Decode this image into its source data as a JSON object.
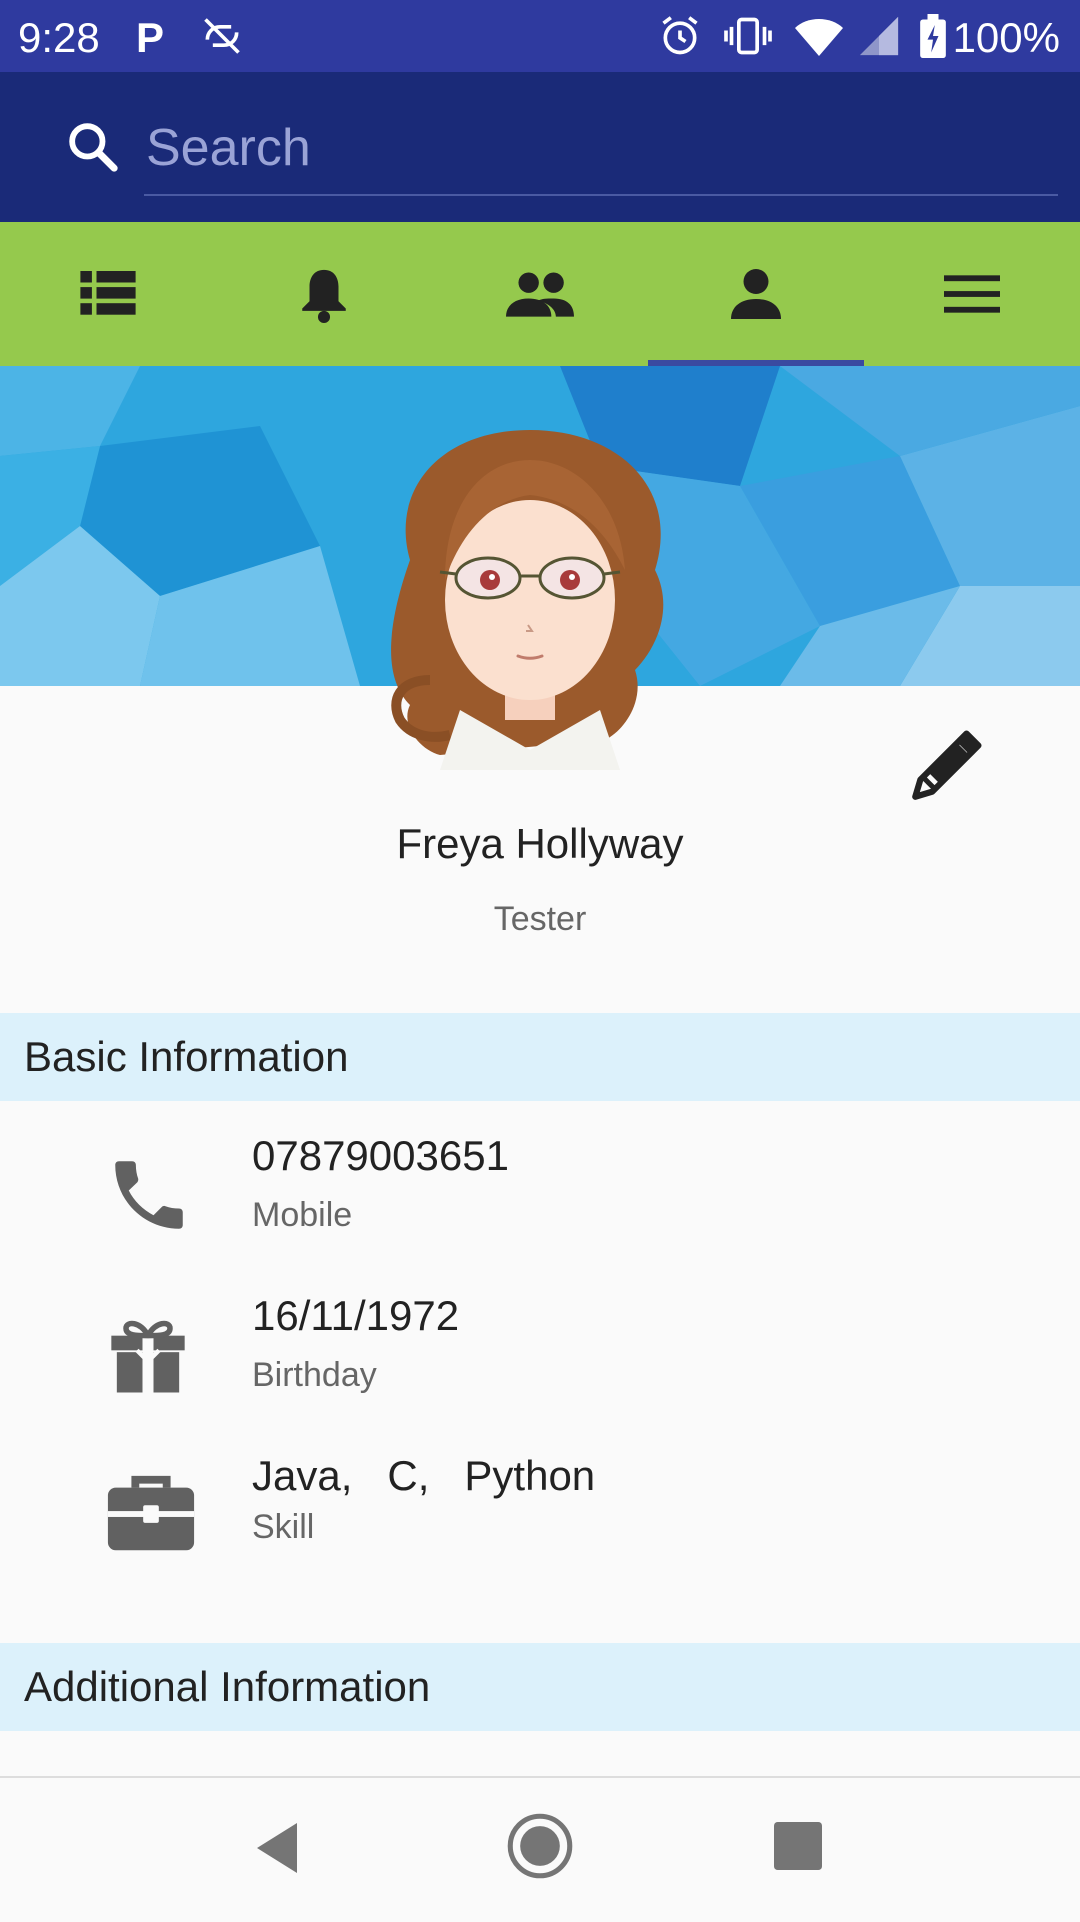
{
  "status_bar": {
    "time": "9:28",
    "p_label": "P",
    "battery_percent": "100%"
  },
  "search": {
    "placeholder": "Search"
  },
  "tabs": [
    {
      "icon": "list-icon",
      "active": false
    },
    {
      "icon": "bell-icon",
      "active": false
    },
    {
      "icon": "group-icon",
      "active": false
    },
    {
      "icon": "person-icon",
      "active": true
    },
    {
      "icon": "menu-icon",
      "active": false
    }
  ],
  "profile": {
    "name": "Freya Hollyway",
    "role": "Tester"
  },
  "sections": {
    "basic": "Basic Information",
    "additional": "Additional Information"
  },
  "basic_info": [
    {
      "icon": "phone-icon",
      "value": "07879003651",
      "label": "Mobile"
    },
    {
      "icon": "gift-icon",
      "value": "16/11/1972",
      "label": "Birthday"
    },
    {
      "icon": "briefcase-icon",
      "value": "Java,   C,   Python",
      "label": "Skill"
    }
  ],
  "colors": {
    "status_bar": "#2f3a9f",
    "search_bar": "#1a2a78",
    "tab_bar": "#95c94d",
    "tab_indicator": "#3a4aa0",
    "section_header": "#dcf1fb"
  }
}
